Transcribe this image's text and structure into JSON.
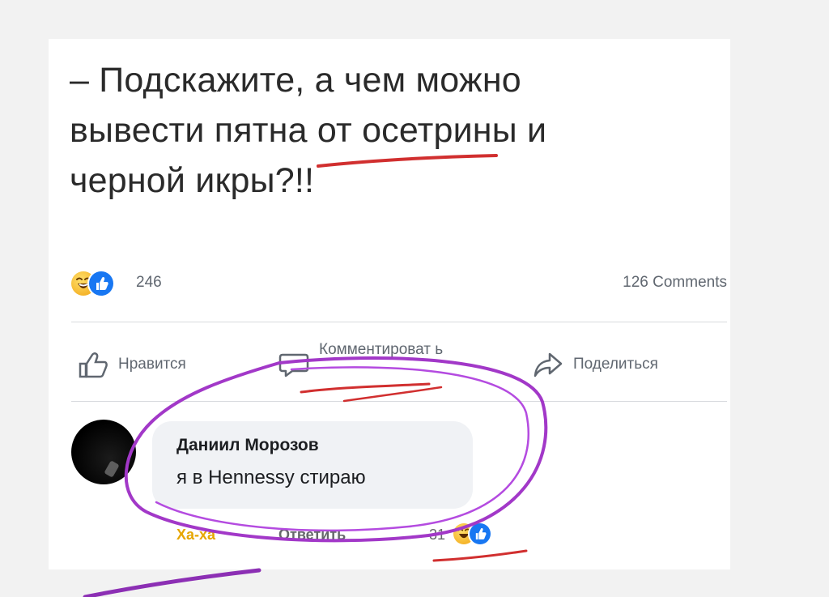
{
  "post": {
    "text_lines": [
      "– Подскажите, а чем можно",
      "вывести пятна от осетрины и",
      "черной икры?!!"
    ]
  },
  "reactions": {
    "icons": [
      "haha-emoji-icon",
      "like-icon"
    ],
    "count": "246",
    "comments_count": "126 Comments"
  },
  "actions": {
    "like_label": "Нравится",
    "comment_label": "Комментироват ь",
    "share_label": "Поделиться"
  },
  "comment": {
    "author": "Даниил Морозов",
    "text": "я в Hennessy стираю",
    "haha_label": "Ха-ха",
    "reply_label": "Ответить",
    "reaction_count": "31"
  },
  "colors": {
    "background": "#f2f2f2",
    "card": "#ffffff",
    "text": "#2a2a2a",
    "muted": "#606770",
    "facebook_blue": "#1877f2",
    "annotation_red": "#d12f2f",
    "annotation_purple": "#a238c8"
  }
}
